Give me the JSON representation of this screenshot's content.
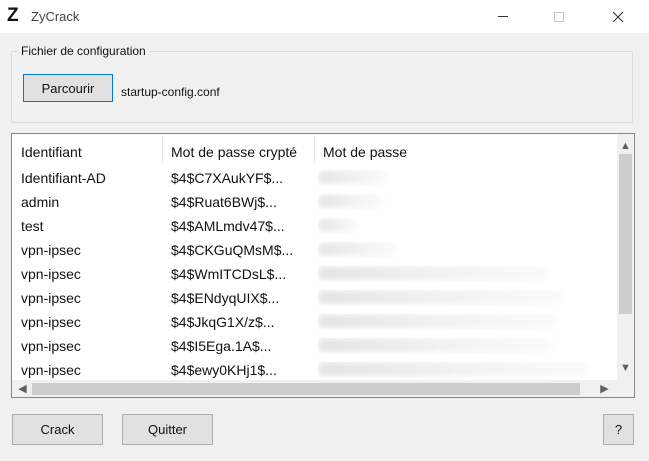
{
  "window": {
    "logo": "Z",
    "title": "ZyCrack",
    "minimize_glyph": "—",
    "close_glyph": "✕"
  },
  "config": {
    "group_label": "Fichier de configuration",
    "browse_label": "Parcourir",
    "file_name": "startup-config.conf"
  },
  "table": {
    "columns": [
      "Identifiant",
      "Mot de passe crypté",
      "Mot de passe"
    ],
    "rows": [
      {
        "id": "Identifiant-AD",
        "hash": "$4$C7XAukYF$..."
      },
      {
        "id": "admin",
        "hash": "$4$Ruat6BWj$..."
      },
      {
        "id": "test",
        "hash": "$4$AMLmdv47$..."
      },
      {
        "id": "vpn-ipsec",
        "hash": "$4$CKGuQMsM$..."
      },
      {
        "id": "vpn-ipsec",
        "hash": "$4$WmITCDsL$..."
      },
      {
        "id": "vpn-ipsec",
        "hash": "$4$ENdyqUIX$..."
      },
      {
        "id": "vpn-ipsec",
        "hash": "$4$JkqG1X/z$..."
      },
      {
        "id": "vpn-ipsec",
        "hash": "$4$I5Ega.1A$..."
      },
      {
        "id": "vpn-ipsec",
        "hash": "$4$ewy0KHj1$..."
      }
    ],
    "password_column_state": "blurred"
  },
  "buttons": {
    "crack": "Crack",
    "quit": "Quitter",
    "help": "?"
  },
  "scroll": {
    "up": "▲",
    "down": "▼",
    "left": "◀",
    "right": "▶"
  },
  "colors": {
    "window_bg": "#f0f0f0",
    "focus_border": "#0078d7"
  }
}
